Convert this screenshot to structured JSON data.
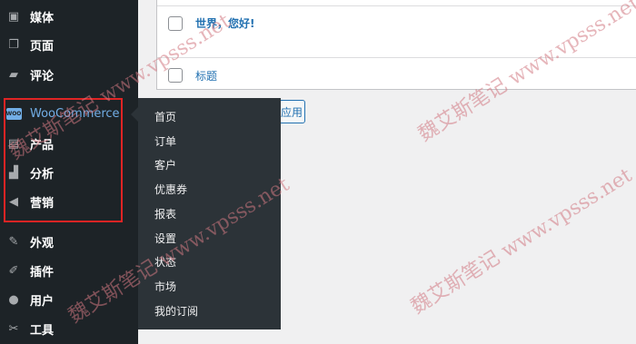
{
  "sidebar": {
    "items": [
      {
        "label": "媒体",
        "icon": "media-icon",
        "glyph": "▣"
      },
      {
        "label": "页面",
        "icon": "pages-icon",
        "glyph": "❐"
      },
      {
        "label": "评论",
        "icon": "comments-icon",
        "glyph": "▰"
      },
      {
        "label": "WooCommerce",
        "icon": "woocommerce-icon",
        "glyph": "WOO"
      },
      {
        "label": "产品",
        "icon": "products-icon",
        "glyph": "▤"
      },
      {
        "label": "分析",
        "icon": "analytics-icon",
        "glyph": "▟"
      },
      {
        "label": "营销",
        "icon": "marketing-icon",
        "glyph": "◀"
      },
      {
        "label": "外观",
        "icon": "appearance-icon",
        "glyph": "✎"
      },
      {
        "label": "插件",
        "icon": "plugins-icon",
        "glyph": "✐"
      },
      {
        "label": "用户",
        "icon": "users-icon",
        "glyph": "●"
      },
      {
        "label": "工具",
        "icon": "tools-icon",
        "glyph": "✂"
      }
    ]
  },
  "submenu": {
    "items": [
      "首页",
      "订单",
      "客户",
      "优惠券",
      "报表",
      "设置",
      "状态",
      "市场",
      "我的订阅"
    ]
  },
  "table": {
    "rows": [
      {
        "title": "世界，您好!"
      },
      {
        "title": "标题"
      }
    ]
  },
  "bulk_action": {
    "apply_label": "应用"
  },
  "watermark": {
    "text": "魏艾斯笔记 www.vpsss.net"
  },
  "colors": {
    "sidebar": "#1d2327",
    "submenu": "#2c3338",
    "accent": "#72aee6",
    "link": "#2271b1",
    "highlight": "#e02424"
  }
}
